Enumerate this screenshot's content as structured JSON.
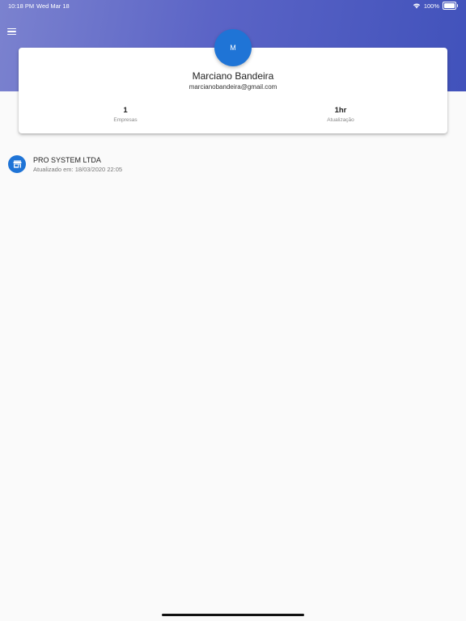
{
  "status_bar": {
    "time": "10:18 PM",
    "date": "Wed Mar 18",
    "battery": "100%"
  },
  "header": {
    "menu_icon": "hamburger-menu-icon",
    "gradient_start": "#7b82cf",
    "gradient_end": "#4152bb"
  },
  "profile": {
    "avatar_initial": "M",
    "name": "Marciano Bandeira",
    "email": "marcianobandeira@gmail.com",
    "avatar_color": "#1f74d6",
    "stats": [
      {
        "value": "1",
        "label": "Empresas"
      },
      {
        "value": "1hr",
        "label": "Atualização"
      }
    ]
  },
  "companies": [
    {
      "icon": "store-icon",
      "name": "PRO SYSTEM LTDA",
      "updated": "Atualizado em: 18/03/2020 22:05"
    }
  ]
}
